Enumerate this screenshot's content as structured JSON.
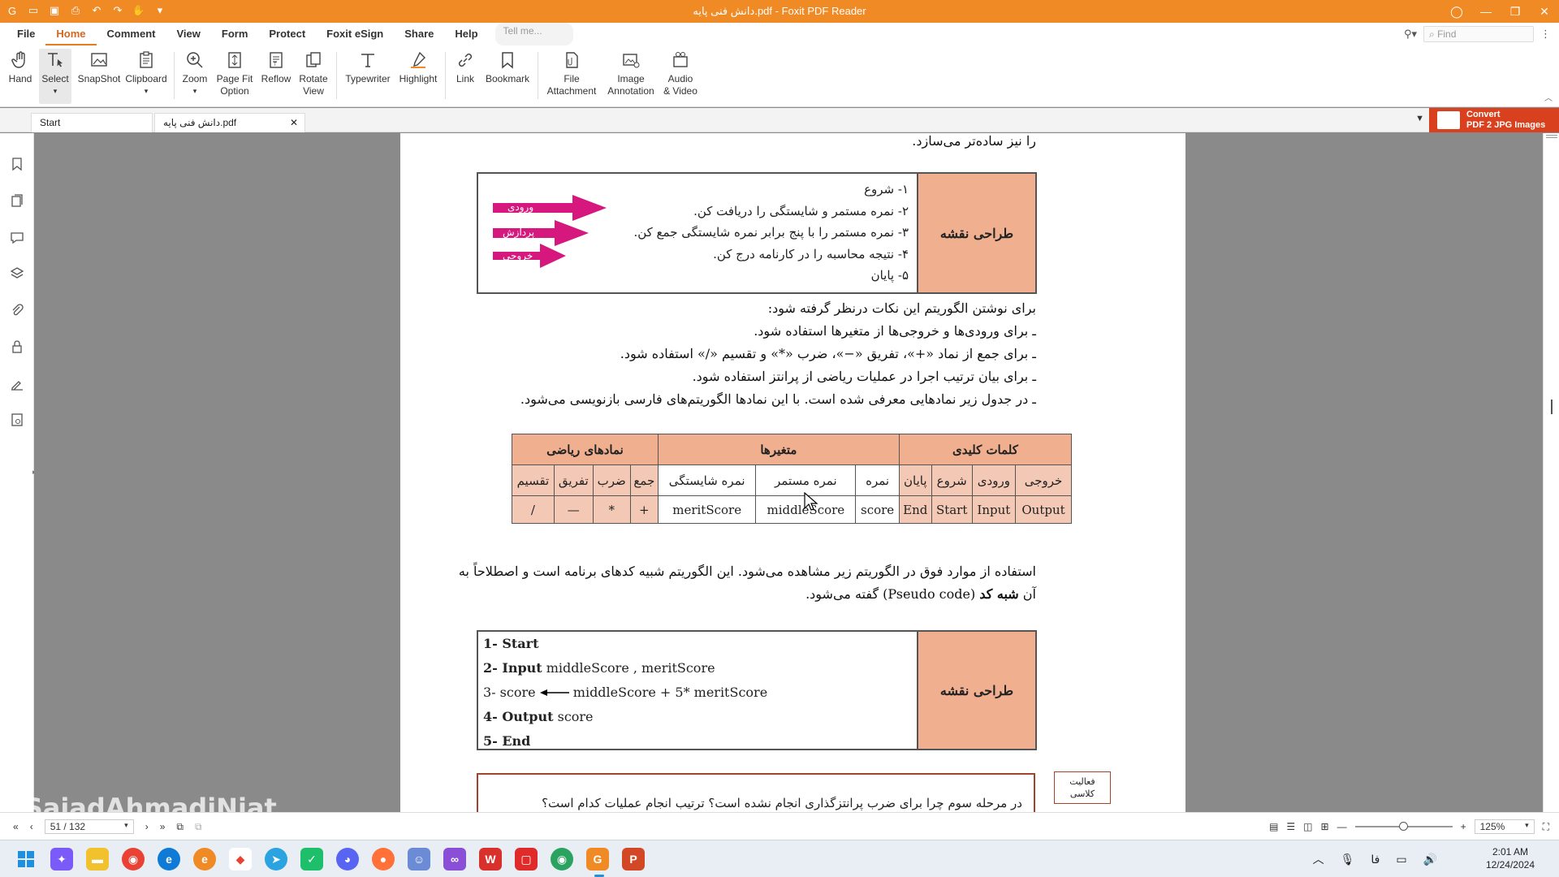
{
  "app": {
    "title": "دانش فنی پایه.pdf - Foxit PDF Reader",
    "accent": "#f08a24"
  },
  "menu": {
    "items": [
      "File",
      "Home",
      "Comment",
      "View",
      "Form",
      "Protect",
      "Foxit eSign",
      "Share",
      "Help"
    ],
    "active": "Home",
    "tell_me": "Tell me...",
    "find_placeholder": "Find"
  },
  "ribbon": {
    "hand": "Hand",
    "select": "Select",
    "snapshot": "SnapShot",
    "clipboard": "Clipboard",
    "zoom": "Zoom",
    "page_fit_1": "Page Fit",
    "page_fit_2": "Option",
    "reflow": "Reflow",
    "rotate_1": "Rotate",
    "rotate_2": "View",
    "typewriter": "Typewriter",
    "highlight": "Highlight",
    "link": "Link",
    "bookmark": "Bookmark",
    "file_attach_1": "File",
    "file_attach_2": "Attachment",
    "image_annot_1": "Image",
    "image_annot_2": "Annotation",
    "audio_1": "Audio",
    "audio_2": "& Video"
  },
  "tabs": {
    "start": "Start",
    "document": "دانش فنی پایه.pdf",
    "convert_1": "Convert",
    "convert_2": "PDF 2 JPG Images"
  },
  "page": {
    "top_line": "را نیز ساده‌تر می‌سازد.",
    "design_label": "طراحی نقشه",
    "steps": [
      "۱- شروع",
      "۲- نمره مستمر و شایستگی را دریافت کن.",
      "۳- نمره مستمر را با پنج برابر نمره شایستگی جمع کن.",
      "۴- نتیجه محاسبه را در کارنامه درج کن.",
      "۵- پایان"
    ],
    "arrows": [
      "ورودی",
      "پردازش",
      "خروجی"
    ],
    "notes_intro": "برای نوشتن الگوریتم این نکات درنظر گرفته شود:",
    "notes": [
      "ـ برای ورودی‌ها و خروجی‌ها از متغیرها استفاده شود.",
      "ـ برای جمع از نماد «+»، تفریق «−»، ضرب «*» و تقسیم «/» استفاده شود.",
      "ـ برای بیان ترتیب اجرا در عملیات ریاضی از پرانتز استفاده شود.",
      "ـ در جدول زیر نمادهایی معرفی شده است. با این نمادها الگوریتم‌های فارسی بازنویسی می‌شود."
    ],
    "table": {
      "group_headers": [
        "کلمات کلیدی",
        "متغیرها",
        "نمادهای ریاضی"
      ],
      "persian": [
        "خروجی",
        "ورودی",
        "شروع",
        "پایان",
        "نمره",
        "نمره مستمر",
        "نمره شایستگی",
        "جمع",
        "ضرب",
        "تفریق",
        "تقسیم"
      ],
      "english": [
        "Output",
        "Input",
        "Start",
        "End",
        "score",
        "middleScore",
        "meritScore",
        "+",
        "*",
        "—",
        "/"
      ]
    },
    "para_1": "استفاده از موارد فوق در الگوریتم زیر مشاهده می‌شود. این الگوریتم شبیه کدهای برنامه است و اصطلاحاً به",
    "para_2a": "آن ",
    "para_2b": "شبه کد",
    "para_2c": " (Pseudo code) گفته می‌شود.",
    "code": {
      "l1_num": "1- ",
      "l1_kw": "Start",
      "l2_num": "2- ",
      "l2_kw": "Input",
      "l2_rest": " middleScore , meritScore",
      "l3_a": "3- score ",
      "l3_b": " middleScore  + 5* meritScore",
      "l4_num": "4- ",
      "l4_kw": "Output",
      "l4_rest": " score",
      "l5_num": "5- ",
      "l5_kw": "End"
    },
    "question": "در مرحله سوم چرا برای ضرب پرانتزگذاری انجام نشده است؟ ترتیب انجام عملیات کدام است؟",
    "activity_1": "فعالیت",
    "activity_2": "کلاسی"
  },
  "status": {
    "page_indicator": "51 / 132",
    "zoom": "125%",
    "watermark": "/SajadAhmadiNiat"
  },
  "taskbar": {
    "time": "2:01 AM",
    "date": "12/24/2024",
    "lang": "فا"
  }
}
